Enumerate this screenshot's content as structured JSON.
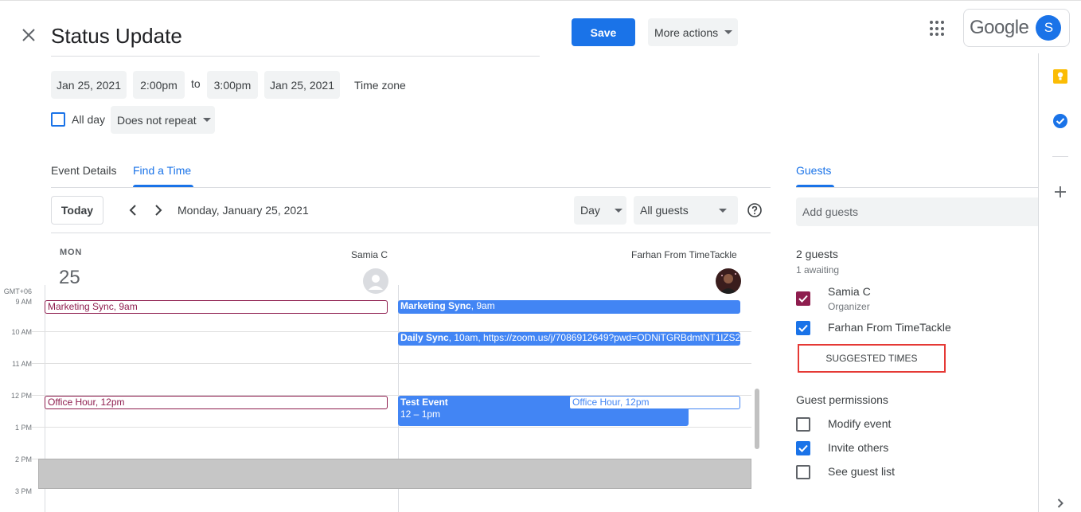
{
  "header": {
    "title": "Status Update",
    "save_label": "Save",
    "more_actions_label": "More actions",
    "account_brand": "Google",
    "account_initial": "S"
  },
  "datetime": {
    "start_date": "Jan 25, 2021",
    "start_time": "2:00pm",
    "to_label": "to",
    "end_time": "3:00pm",
    "end_date": "Jan 25, 2021",
    "timezone_label": "Time zone",
    "all_day_label": "All day",
    "repeat_value": "Does not repeat"
  },
  "tabs": {
    "event_details": "Event Details",
    "find_a_time": "Find a Time",
    "guests": "Guests"
  },
  "find_time": {
    "today_label": "Today",
    "date_label": "Monday, January 25, 2021",
    "view_value": "Day",
    "guests_filter_value": "All guests",
    "day_name": "MON",
    "day_number": "25",
    "timezone": "GMT+06",
    "people": [
      {
        "name": "Samia C"
      },
      {
        "name": "Farhan From TimeTackle"
      }
    ],
    "hours": [
      "9 AM",
      "10 AM",
      "11 AM",
      "12 PM",
      "1 PM",
      "2 PM",
      "3 PM"
    ],
    "events": {
      "samia_marketing": {
        "title": "Marketing Sync",
        "time": ", 9am"
      },
      "samia_office": {
        "title": "Office Hour",
        "time": ", 12pm"
      },
      "farhan_marketing": {
        "title": "Marketing Sync",
        "time": ", 9am"
      },
      "farhan_daily": {
        "title": "Daily Sync",
        "time": ", 10am, https://zoom.us/j/7086912649?pwd=ODNiTGRBdmtNT1lZS2"
      },
      "farhan_test": {
        "title": "Test Event",
        "time": "12 – 1pm"
      },
      "farhan_office": {
        "title": "Office Hour",
        "time": ", 12pm"
      }
    }
  },
  "guests": {
    "add_placeholder": "Add guests",
    "count_label": "2 guests",
    "awaiting_label": "1 awaiting",
    "list": [
      {
        "name": "Samia C",
        "role": "Organizer"
      },
      {
        "name": "Farhan From TimeTackle"
      }
    ],
    "suggested_times_label": "SUGGESTED TIMES",
    "permissions_title": "Guest permissions",
    "permissions": {
      "modify_event": "Modify event",
      "invite_others": "Invite others",
      "see_guest_list": "See guest list"
    }
  },
  "colors": {
    "accent": "#1a73e8",
    "samia_event": "#8e1d4e",
    "farhan_event": "#4285f4",
    "highlight_border": "#e53935"
  },
  "icons": [
    "close-icon",
    "caret-down-icon",
    "apps-grid-icon",
    "chevron-left-icon",
    "chevron-right-icon",
    "help-icon",
    "keep-icon",
    "tasks-icon",
    "add-icon",
    "expand-panel-icon"
  ]
}
